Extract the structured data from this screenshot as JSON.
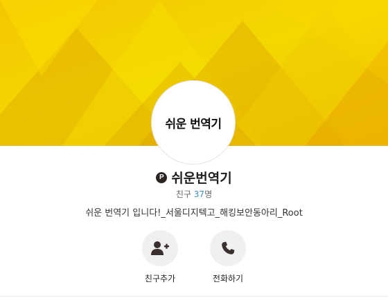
{
  "profile": {
    "avatar_text": "쉬운 번역기",
    "badge_glyph": "P",
    "name": "쉬운번역기",
    "friends_label": "친구",
    "friends_count": "37",
    "friends_unit": "명",
    "description": "쉬운 번역기 입니다!_서울디지텍고_해킹보안동아리_Root"
  },
  "actions": {
    "add_friend": {
      "label": "친구추가",
      "icon": "add-friend-icon"
    },
    "call": {
      "label": "전화하기",
      "icon": "phone-icon"
    }
  },
  "colors": {
    "cover_yellow": "#f2d400",
    "cover_orange": "#e8a400",
    "link_blue": "#3d8ec9",
    "badge_dark": "#2b2222"
  }
}
